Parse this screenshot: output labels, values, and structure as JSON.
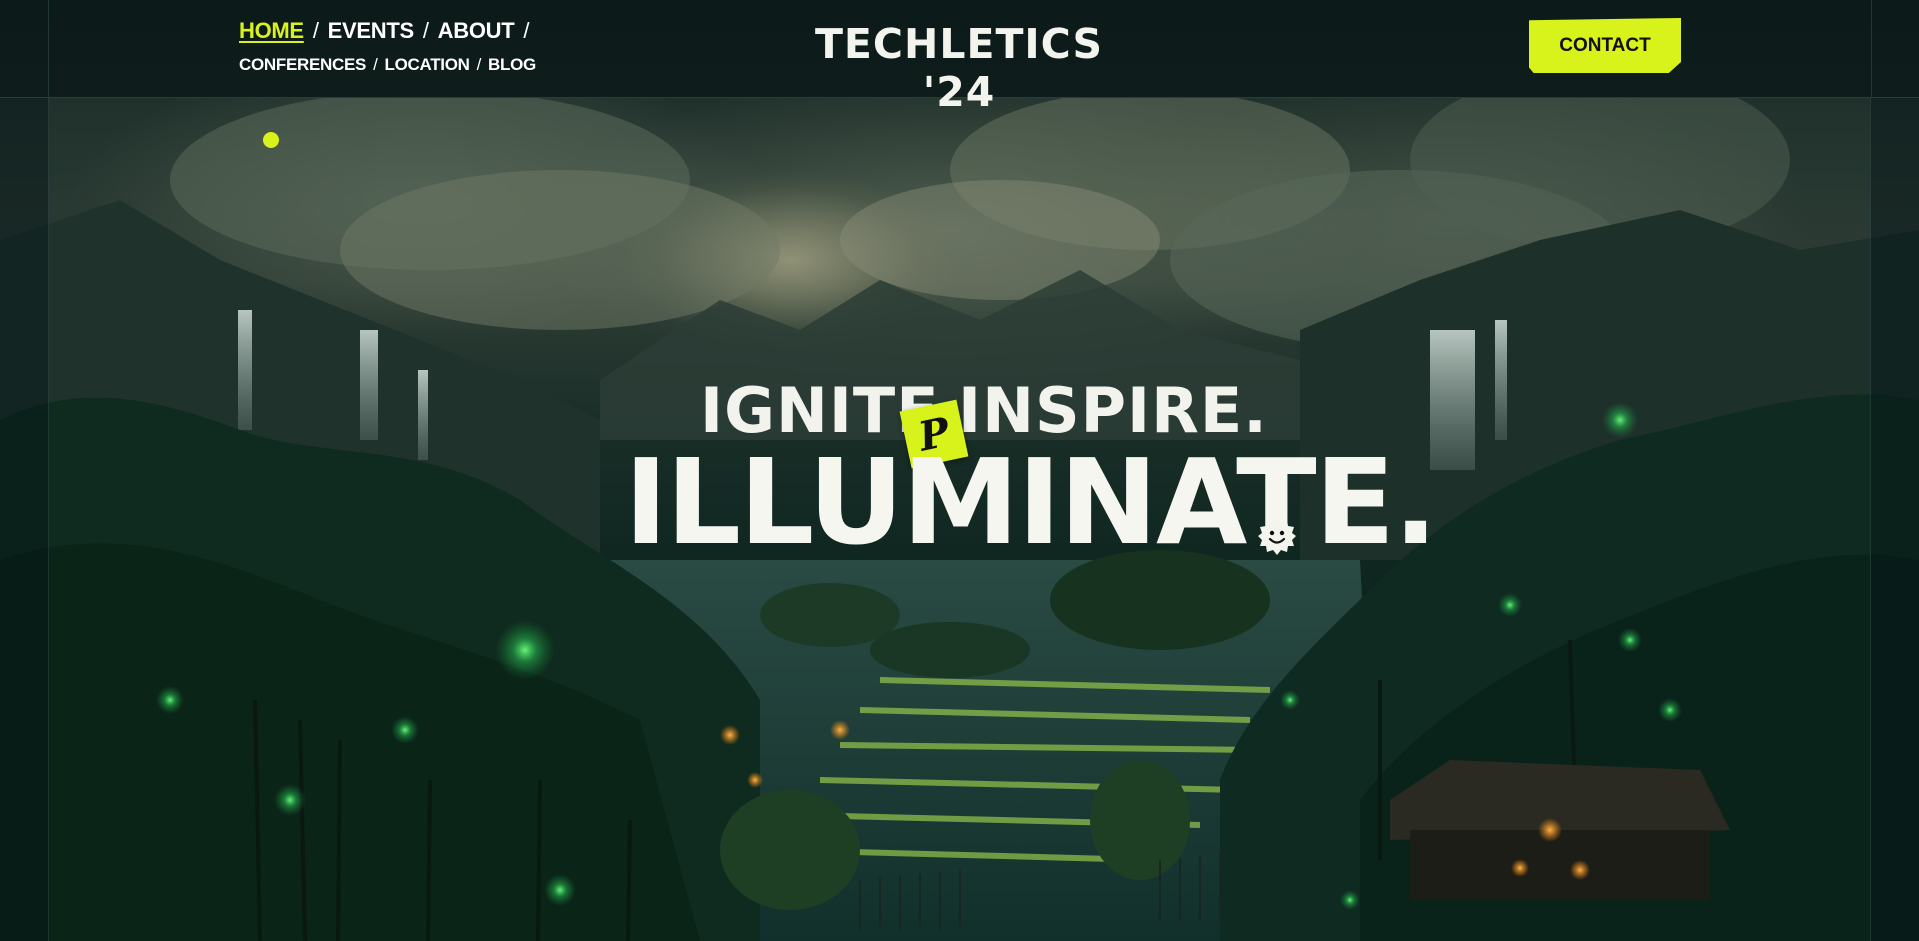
{
  "header": {
    "nav_primary": [
      {
        "label": "HOME",
        "active": true
      },
      {
        "label": "EVENTS",
        "active": false
      },
      {
        "label": "ABOUT",
        "active": false
      }
    ],
    "nav_secondary": [
      {
        "label": "CONFERENCES"
      },
      {
        "label": "LOCATION"
      },
      {
        "label": "BLOG"
      }
    ],
    "separator": "/",
    "brand": "TECHLETICS '24",
    "contact_label": "CONTACT"
  },
  "hero": {
    "tagline_word1": "IGNITE.",
    "tagline_word2": "INSPIRE.",
    "headline": "ILLUMINATE.",
    "sticker_glyph": "P"
  },
  "colors": {
    "accent": "#d8f21c",
    "header_bg": "#0c1a19",
    "text": "#ffffff"
  },
  "icons": {
    "sticker": "ticket-sticker-icon",
    "smiley": "smiley-badge-icon",
    "marker": "dot-marker-icon"
  }
}
